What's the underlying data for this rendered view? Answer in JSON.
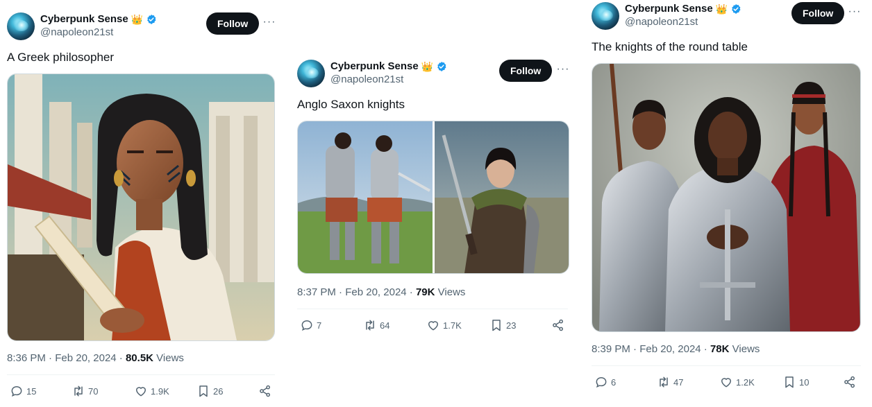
{
  "tweets": [
    {
      "author": {
        "name": "Cyberpunk Sense",
        "badge": "👑",
        "handle": "@napoleon21st"
      },
      "follow_label": "Follow",
      "more_label": "···",
      "text": "A Greek philosopher",
      "image_description": "Painting of a long-haired man with face paint wearing a red and white toga, holding a scroll among classical columns",
      "time": "8:36 PM",
      "sep1": " · ",
      "date": "Feb 20, 2024",
      "sep2": " · ",
      "views_count": "80.5K",
      "views_label": " Views",
      "counts": {
        "replies": "15",
        "reposts": "70",
        "likes": "1.9K",
        "bookmarks": "26"
      }
    },
    {
      "author": {
        "name": "Cyberpunk Sense",
        "badge": "👑",
        "handle": "@napoleon21st"
      },
      "follow_label": "Follow",
      "more_label": "···",
      "text": "Anglo Saxon knights",
      "image_description": "Two images: armored warriors fighting on a grassy field, and a woman in armor holding a sword",
      "time": "8:37 PM",
      "sep1": " · ",
      "date": "Feb 20, 2024",
      "sep2": " · ",
      "views_count": "79K",
      "views_label": " Views",
      "counts": {
        "replies": "7",
        "reposts": "64",
        "likes": "1.7K",
        "bookmarks": "23"
      }
    },
    {
      "author": {
        "name": "Cyberpunk Sense",
        "badge": "👑",
        "handle": "@napoleon21st"
      },
      "follow_label": "Follow",
      "more_label": "···",
      "text": "The knights of the round table",
      "image_description": "Painting of three people in plate armor and red robes standing with a sword and a spear",
      "time": "8:39 PM",
      "sep1": " · ",
      "date": "Feb 20, 2024",
      "sep2": " · ",
      "views_count": "78K",
      "views_label": " Views",
      "counts": {
        "replies": "6",
        "reposts": "47",
        "likes": "1.2K",
        "bookmarks": "10"
      }
    }
  ],
  "colors": {
    "verified": "#1d9bf0",
    "text": "#0f1419",
    "secondary": "#536471",
    "follow_bg": "#0f1419"
  }
}
